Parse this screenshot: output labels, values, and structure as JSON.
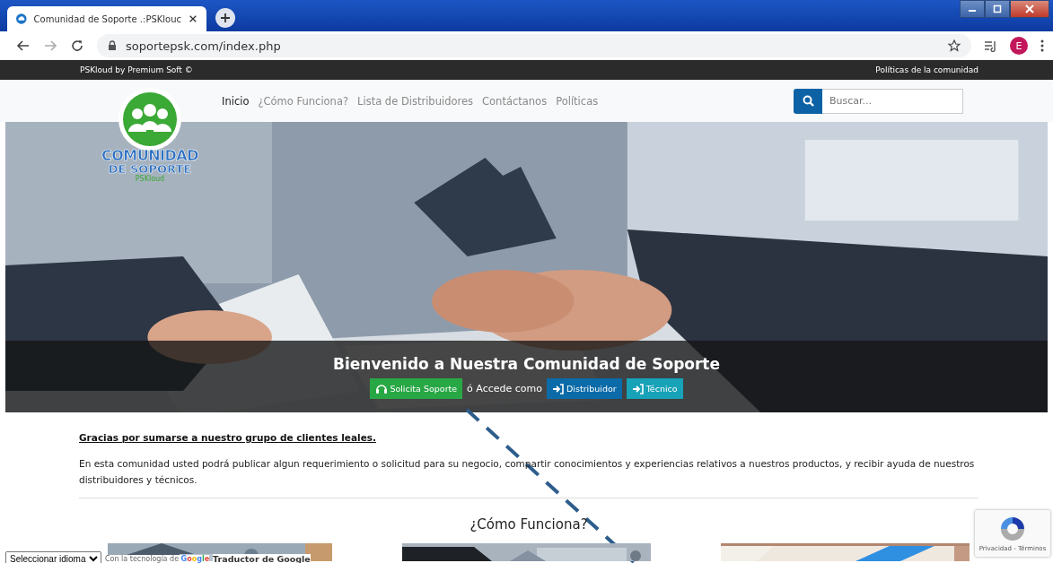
{
  "browser": {
    "tab_title": "Comunidad de Soporte .:PSKlouc",
    "url": "soportepsk.com/index.php",
    "profile_initial": "E"
  },
  "top_bar": {
    "left": "PSKloud by Premium Soft ©",
    "right": "Políticas de la comunidad"
  },
  "logo": {
    "line1": "COMUNIDAD",
    "line2": "DE SOPORTE",
    "line3": "PSKloud"
  },
  "nav": [
    {
      "label": "Inicio",
      "selected": true
    },
    {
      "label": "¿Cómo Funciona?",
      "selected": false
    },
    {
      "label": "Lista de Distribuidores",
      "selected": false
    },
    {
      "label": "Contáctanos",
      "selected": false
    },
    {
      "label": "Políticas",
      "selected": false
    }
  ],
  "search": {
    "placeholder": "Buscar..."
  },
  "hero": {
    "kind": "picture",
    "title": "Bienvenido a Nuestra Comunidad de Soporte",
    "actions": [
      {
        "kind": "support",
        "label": "Solicita Soporte",
        "color": "#28a745"
      },
      {
        "kind": "text",
        "label": "ó Accede como"
      },
      {
        "kind": "login",
        "label": "Distribuidor",
        "color": "#0b6aa8"
      },
      {
        "kind": "login",
        "label": "Técnico",
        "color": "#17a2b8"
      }
    ]
  },
  "intro": {
    "heading": "Gracias por sumarse a nuestro grupo de clientes leales.",
    "paragraph": "En esta comunidad usted podrá publicar algun requerimiento o solicitud para su negocio, compartir conocimientos y experiencias relativos a nuestros productos, y recibir ayuda de nuestros distribuidores y técnicos."
  },
  "section_title": "¿Cómo Funciona?",
  "language_select": {
    "value": "Seleccionar idioma"
  },
  "translate_credit": {
    "prefix": "Con la tecnología de",
    "brand": "Google",
    "suffix": "Traductor de Google"
  },
  "recaptcha": {
    "links": "Privacidad - Términos"
  },
  "annotation": {
    "kind": "dashed-arrow"
  }
}
